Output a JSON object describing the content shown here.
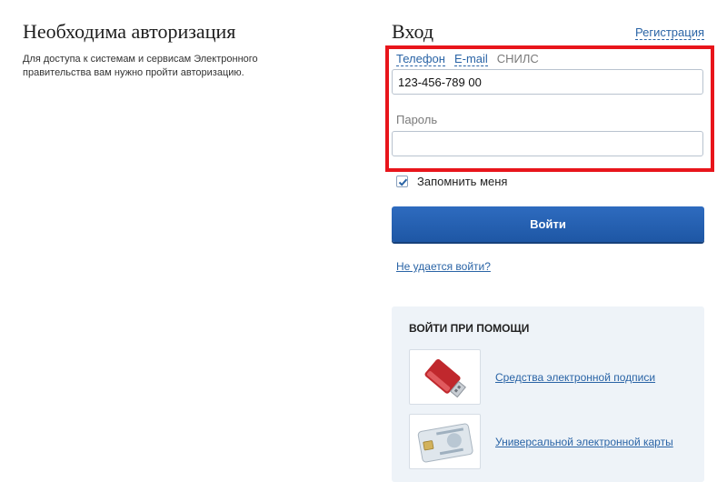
{
  "left": {
    "title": "Необходима авторизация",
    "description": "Для доступа к системам и сервисам Электронного правительства вам нужно пройти авторизацию."
  },
  "login": {
    "title": "Вход",
    "register_link": "Регистрация",
    "tabs": [
      "Телефон",
      "E-mail",
      "СНИЛС"
    ],
    "login_value": "123-456-789 00",
    "password_label": "Пароль",
    "password_value": "",
    "remember_label": "Запомнить меня",
    "remember_checked": true,
    "submit_label": "Войти",
    "cant_login_link": "Не удается войти?"
  },
  "alt_login": {
    "title": "ВОЙТИ ПРИ ПОМОЩИ",
    "items": [
      {
        "label": "Средства электронной подписи",
        "icon": "usb-token-icon"
      },
      {
        "label": "Универсальной электронной карты",
        "icon": "smart-card-icon"
      }
    ]
  },
  "colors": {
    "accent": "#2a64a6",
    "button": "#2e6bbf",
    "highlight": "#e8151b",
    "panel": "#eef3f8"
  }
}
